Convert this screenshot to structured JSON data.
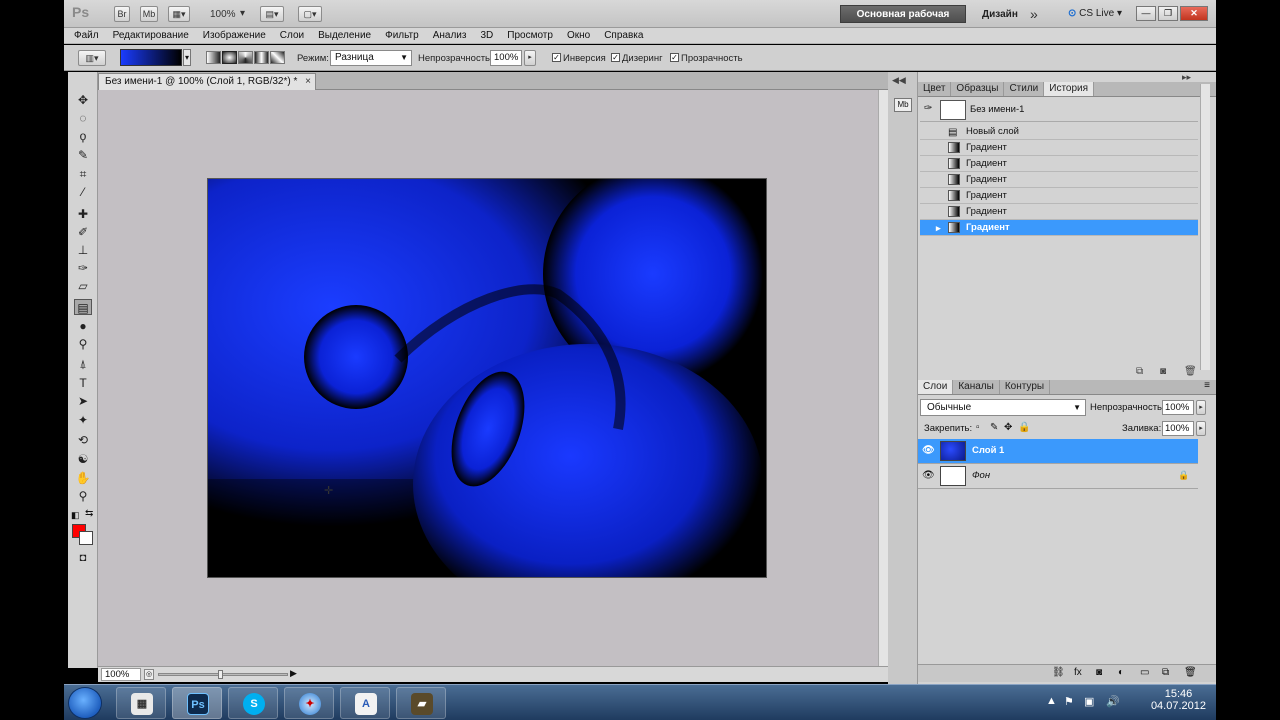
{
  "app": {
    "logo": "Ps",
    "bridge_btn": "Br",
    "minibridge_btn": "Mb",
    "zoom": "100%",
    "workspace": "Основная рабочая среда",
    "design": "Дизайн",
    "more": "»",
    "cs_live": "CS Live"
  },
  "menu": [
    "Файл",
    "Редактирование",
    "Изображение",
    "Слои",
    "Выделение",
    "Фильтр",
    "Анализ",
    "3D",
    "Просмотр",
    "Окно",
    "Справка"
  ],
  "options": {
    "mode_label": "Режим:",
    "mode_value": "Разница",
    "opacity_label": "Непрозрачность:",
    "opacity_value": "100%",
    "reverse_label": "Инверсия",
    "dither_label": "Дизеринг",
    "transparency_label": "Прозрачность"
  },
  "document": {
    "tab_title": "Без имени-1 @ 100% (Слой 1, RGB/32*) *",
    "close": "×",
    "zoom_status": "100%"
  },
  "history": {
    "tabs": [
      "Цвет",
      "Образцы",
      "Стили",
      "История"
    ],
    "active_tab": "История",
    "snapshot_label": "Без имени-1",
    "rows": [
      "Новый слой",
      "Градиент",
      "Градиент",
      "Градиент",
      "Градиент",
      "Градиент",
      "Градиент"
    ]
  },
  "layers": {
    "tabs": [
      "Слои",
      "Каналы",
      "Контуры"
    ],
    "active_tab": "Слои",
    "blend_mode": "Обычные",
    "opacity_label": "Непрозрачность:",
    "opacity_value": "100%",
    "lock_label": "Закрепить:",
    "fill_label": "Заливка:",
    "fill_value": "100%",
    "items": [
      {
        "name": "Слой 1",
        "active": true
      },
      {
        "name": "Фон",
        "active": false
      }
    ]
  },
  "taskbar": {
    "time": "15:46",
    "date": "04.07.2012",
    "apps": [
      "calendar",
      "Ps",
      "S",
      "safari",
      "document",
      "video"
    ]
  },
  "colors": {
    "foreground": "#ff0000",
    "background": "#ffffff",
    "selection": "#3b99fc"
  }
}
